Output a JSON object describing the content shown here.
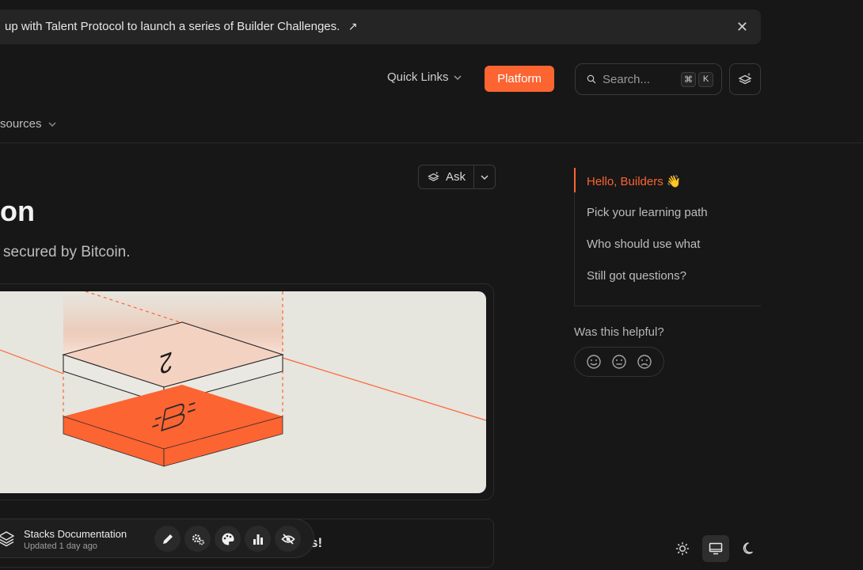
{
  "banner": {
    "text": "up with Talent Protocol to launch a series of Builder Challenges.",
    "arrow": "↗",
    "close": "✕"
  },
  "nav": {
    "quick_links": "Quick Links",
    "platform": "Platform",
    "search_placeholder": "Search...",
    "shortcut": [
      "⌘",
      "K"
    ]
  },
  "subnav": {
    "resources": "sources"
  },
  "ask": {
    "label": "Ask"
  },
  "page": {
    "title": "on",
    "subtitle": "secured by Bitcoin.",
    "card_text": "s!"
  },
  "toolbar": {
    "title": "Stacks Documentation",
    "updated": "Updated 1 day ago",
    "icons": [
      "pencil-icon",
      "gears-icon",
      "palette-icon",
      "bar-chart-icon",
      "eye-slash-icon"
    ]
  },
  "toc": {
    "items": [
      {
        "label": "Hello, Builders 👋",
        "active": true
      },
      {
        "label": "Pick your learning path",
        "active": false
      },
      {
        "label": "Who should use what",
        "active": false
      },
      {
        "label": "Still got questions?",
        "active": false
      }
    ]
  },
  "feedback": {
    "question": "Was this helpful?",
    "options": [
      "happy-face-icon",
      "neutral-face-icon",
      "sad-face-icon"
    ]
  },
  "theme": {
    "options": [
      "sun-icon",
      "monitor-icon",
      "moon-icon"
    ],
    "selected": "monitor-icon"
  },
  "colors": {
    "accent": "#fc6432",
    "background": "#171717",
    "hero_bg": "#e6e5de"
  }
}
